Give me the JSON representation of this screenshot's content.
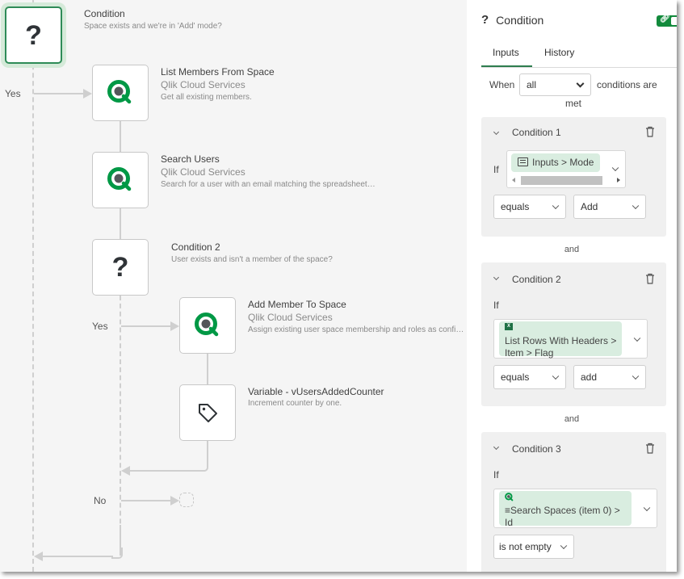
{
  "canvas": {
    "nodes": [
      {
        "id": "condition",
        "title": "Condition",
        "description": "Space exists and we're in 'Add' mode?",
        "icon": "question-icon",
        "selected": true
      },
      {
        "id": "list-members",
        "title": "List Members From Space",
        "subtitle": "Qlik Cloud Services",
        "description": "Get all existing members.",
        "icon": "qlik-icon"
      },
      {
        "id": "search-users",
        "title": "Search Users",
        "subtitle": "Qlik Cloud Services",
        "description": "Search for a user with an email matching the spreadsheet…",
        "icon": "qlik-icon"
      },
      {
        "id": "condition-2",
        "title": "Condition 2",
        "description": "User exists and isn't a member of the space?",
        "icon": "question-icon"
      },
      {
        "id": "add-member",
        "title": "Add Member To Space",
        "subtitle": "Qlik Cloud Services",
        "description": "Assign existing user space membership and roles as confi…",
        "icon": "qlik-icon"
      },
      {
        "id": "variable",
        "title": "Variable - vUsersAddedCounter",
        "description": "Increment counter by one.",
        "icon": "tag-icon"
      }
    ],
    "branch_labels": {
      "yes_1": "Yes",
      "yes_2": "Yes",
      "no_2": "No"
    }
  },
  "panel": {
    "title": "Condition",
    "title_icon": "question-icon",
    "toggle_icon": "link-icon",
    "accent_color": "#128a3c",
    "tabs": [
      {
        "label": "Inputs",
        "active": true
      },
      {
        "label": "History",
        "active": false
      }
    ],
    "when_prefix": "When",
    "when_value": "all",
    "when_suffix": "conditions are",
    "when_suffix_2": "met",
    "conditions": [
      {
        "title": "Condition 1",
        "if_label": "If",
        "field_chip": {
          "icon": "list-icon",
          "parts": [
            "Inputs",
            "Mode"
          ]
        },
        "operator": "equals",
        "value": "Add"
      },
      {
        "title": "Condition 2",
        "if_label": "If",
        "field_chip": {
          "icon": "excel-icon",
          "line1": "List Rows With Headers",
          "line2_a": "Item",
          "line2_b": "Flag"
        },
        "operator": "equals",
        "value": "add"
      },
      {
        "title": "Condition 3",
        "if_label": "If",
        "field_chip": {
          "icon": "qlik-icon",
          "line1": "Search Spaces (item 0)",
          "line2": "Id"
        },
        "operator": "is not empty"
      }
    ],
    "joiner": "and",
    "separator": ">"
  }
}
